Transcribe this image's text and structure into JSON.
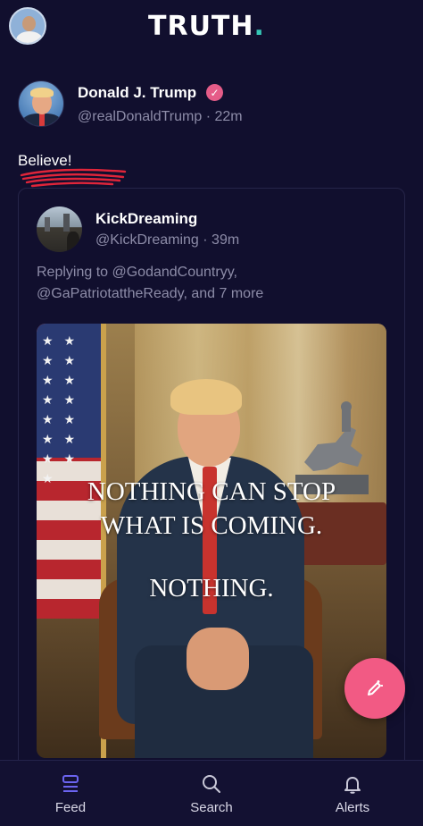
{
  "app": {
    "logo_text": "TRUTH",
    "logo_dot": ".",
    "accent": "#f25a84",
    "logo_dot_color": "#35c7b6"
  },
  "post": {
    "display_name": "Donald J. Trump",
    "handle_time": "@realDonaldTrump · 22m",
    "text": "Believe!",
    "verified_icon": "verified-check-icon"
  },
  "quoted_post": {
    "display_name": "KickDreaming",
    "handle_time": "@KickDreaming · 39m",
    "reply_line1": "Replying to @GodandCountryy,",
    "reply_line2": "@GaPatriotattheReady, and 7 more",
    "image_text": {
      "line1": "NOTHING CAN STOP",
      "line2": "WHAT IS COMING.",
      "line3": "NOTHING."
    }
  },
  "fab": {
    "icon": "compose-icon"
  },
  "nav": {
    "items": [
      {
        "label": "Feed",
        "icon": "feed-icon",
        "active": true
      },
      {
        "label": "Search",
        "icon": "search-icon",
        "active": false
      },
      {
        "label": "Alerts",
        "icon": "bell-icon",
        "active": false
      }
    ]
  }
}
